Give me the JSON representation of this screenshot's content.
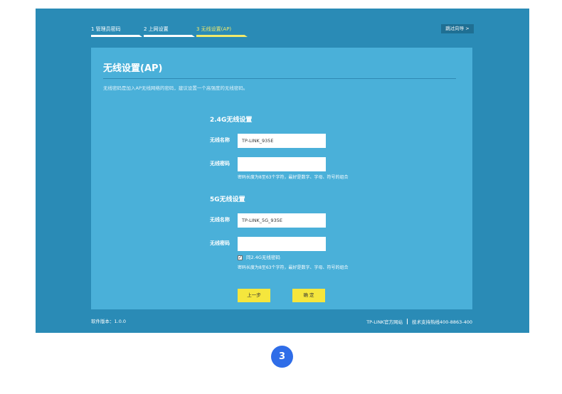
{
  "wizard": {
    "steps": [
      {
        "label": "1 管理员密码"
      },
      {
        "label": "2 上网设置"
      },
      {
        "label": "3 无线设置(AP)"
      }
    ],
    "skip_label": "跳过向导 >"
  },
  "panel": {
    "title": "无线设置(AP)",
    "description": "无线密码是加入AP无线网络的密码，建议设置一个高强度的无线密码。"
  },
  "band24": {
    "section_title": "2.4G无线设置",
    "ssid_label": "无线名称",
    "ssid_value": "TP-LINK_935E",
    "password_label": "无线密码",
    "password_value": "",
    "hint": "密码长度为8至63个字符，最好是数字、字母、符号的组合"
  },
  "band5": {
    "section_title": "5G无线设置",
    "ssid_label": "无线名称",
    "ssid_value": "TP-LINK_5G_935E",
    "password_label": "无线密码",
    "password_value": "",
    "sync_checkbox_label": "同2.4G无线密码",
    "sync_checked": true,
    "hint": "密码长度为8至63个字符，最好是数字、字母、符号的组合"
  },
  "buttons": {
    "prev_label": "上一步",
    "confirm_label": "确 定"
  },
  "footer": {
    "version": "软件版本：1.0.0",
    "site_link": "TP-LINK官方网站",
    "support": "技术支持热线400-8863-400"
  },
  "step_badge": "3",
  "colors": {
    "frame": "#2a8bb6",
    "panel": "#4ab0d9",
    "active_step": "#f2ea6a",
    "button": "#f5e63d",
    "badge": "#2f6de8"
  }
}
